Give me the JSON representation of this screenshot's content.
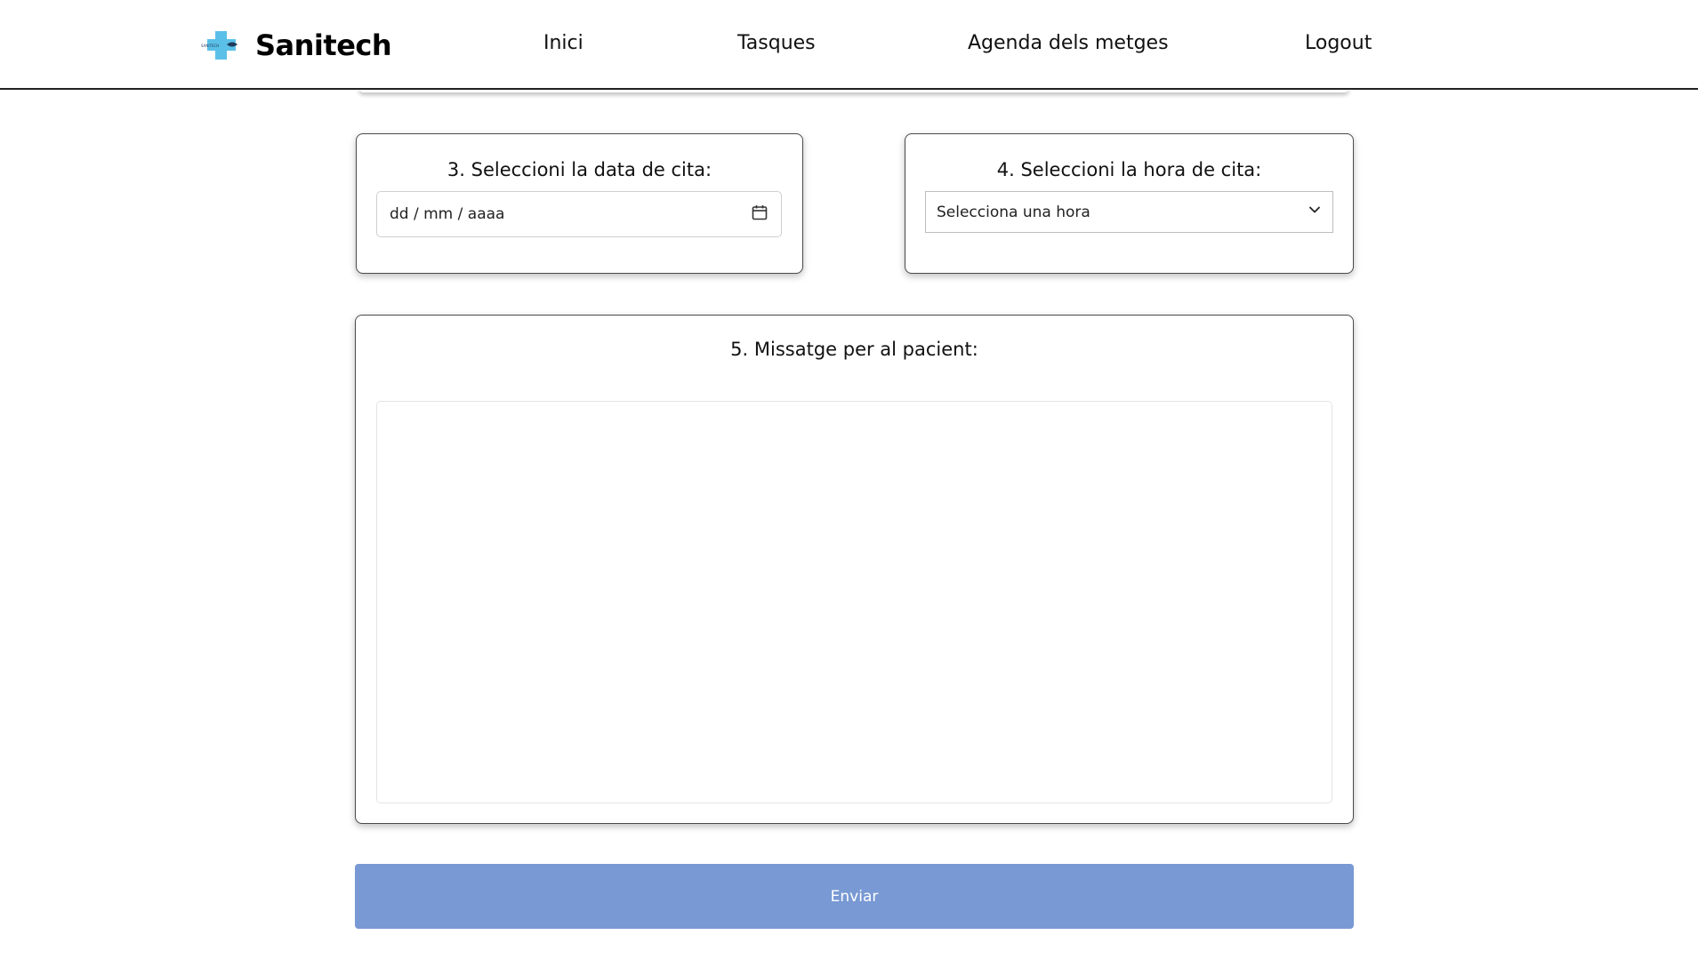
{
  "header": {
    "brand_name": "Sanitech",
    "logo_small_text": "SANITECH",
    "nav": {
      "inici": "Inici",
      "tasques": "Tasques",
      "agenda": "Agenda dels metges",
      "logout": "Logout"
    }
  },
  "date_card": {
    "title": "3. Seleccioni la data de cita:",
    "placeholder": "dd / mm / aaaa",
    "icon": "calendar-icon"
  },
  "hour_card": {
    "title": "4. Seleccioni la hora de cita:",
    "selected": "Selecciona una hora",
    "icon": "chevron-down-icon"
  },
  "message_card": {
    "title": "5. Missatge per al pacient:",
    "value": ""
  },
  "submit": {
    "label": "Enviar"
  },
  "colors": {
    "submit_button": "#7899d3",
    "logo_cross": "#5bc0e8"
  }
}
